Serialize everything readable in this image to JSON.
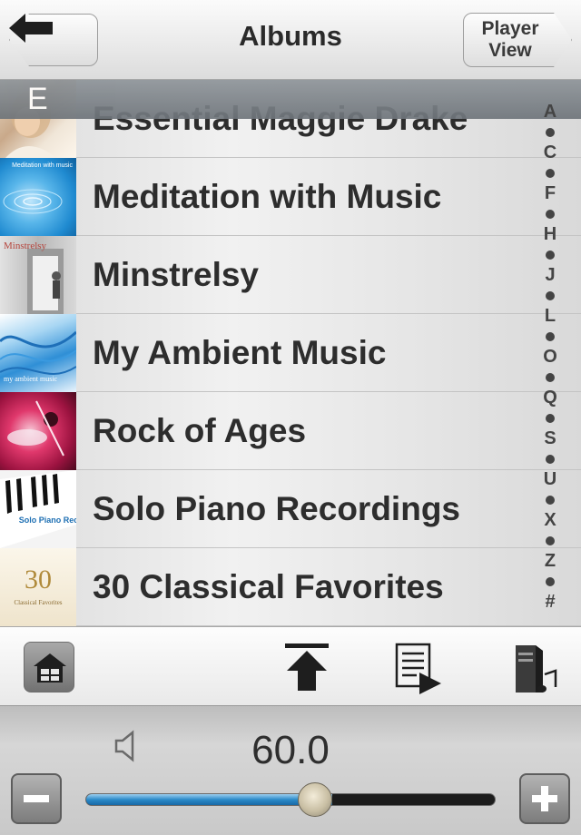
{
  "navbar": {
    "title": "Albums",
    "back_icon": "back-arrow-icon",
    "player_view_line1": "Player",
    "player_view_line2": "View"
  },
  "section_header": {
    "letter": "E"
  },
  "albums": [
    {
      "title": "Essential Maggie Drake",
      "thumb": "portrait-woman",
      "thumb_text": ""
    },
    {
      "title": "Meditation with Music",
      "thumb": "water-ripple",
      "thumb_text": "Meditation with music"
    },
    {
      "title": "Minstrelsy",
      "thumb": "minstrelsy-photo",
      "thumb_text": "Minstrelsy"
    },
    {
      "title": "My Ambient Music",
      "thumb": "blue-waves",
      "thumb_text": "my ambient music"
    },
    {
      "title": "Rock of Ages",
      "thumb": "drummer-red",
      "thumb_text": ""
    },
    {
      "title": "Solo Piano Recordings",
      "thumb": "piano-keys",
      "thumb_text": "Solo Piano Recordings"
    },
    {
      "title": "30 Classical Favorites",
      "thumb": "classical-cream",
      "thumb_text": "30",
      "thumb_text2": "Classical Favorites"
    }
  ],
  "index_letters": [
    "A",
    "C",
    "F",
    "H",
    "J",
    "L",
    "O",
    "Q",
    "S",
    "U",
    "X",
    "Z",
    "#"
  ],
  "toolbar": {
    "home_icon": "home-icon",
    "scroll_top_icon": "scroll-to-top-icon",
    "playlist_icon": "playlist-play-icon",
    "server_music_icon": "music-server-icon"
  },
  "volume": {
    "value": "60.0",
    "level": 0.6,
    "speaker_icon": "speaker-icon",
    "minus_icon": "minus-icon",
    "plus_icon": "plus-icon",
    "fill_color": "#2b8ac9"
  }
}
